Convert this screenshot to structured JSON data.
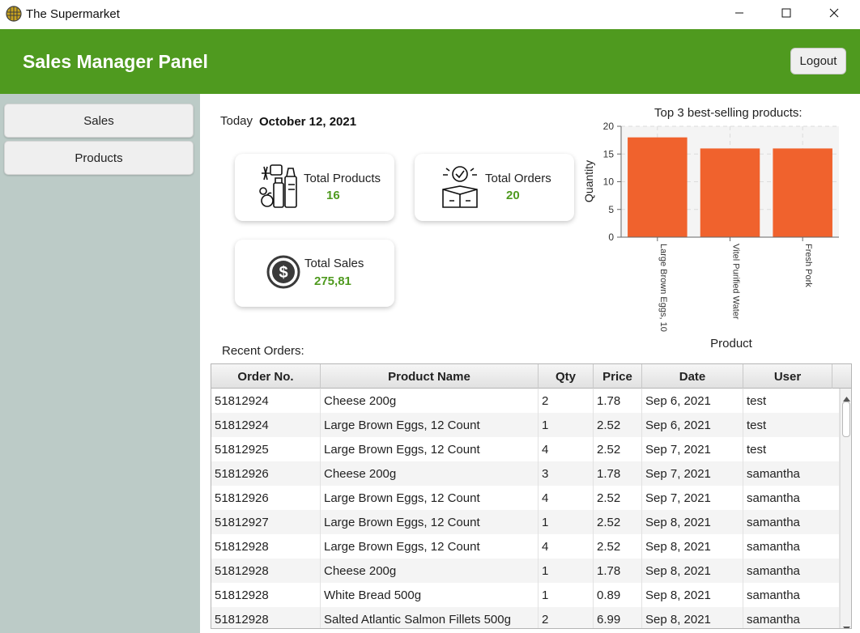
{
  "window": {
    "title": "The Supermarket",
    "app_icon": "basket-globe-icon",
    "controls": [
      "minimize-icon",
      "maximize-icon",
      "close-icon"
    ]
  },
  "header": {
    "title": "Sales Manager Panel",
    "logout_label": "Logout",
    "background": "#4f9a1f"
  },
  "sidebar": {
    "background": "#bccbc7",
    "items": [
      {
        "label": "Sales"
      },
      {
        "label": "Products"
      }
    ]
  },
  "today": {
    "label": "Today",
    "date": "October 12, 2021"
  },
  "cards": {
    "products": {
      "label": "Total Products",
      "value": "16",
      "icon": "groceries-icon"
    },
    "orders": {
      "label": "Total Orders",
      "value": "20",
      "icon": "delivery-box-icon"
    },
    "sales": {
      "label": "Total Sales",
      "value": "275,81",
      "icon": "dollar-coin-icon"
    }
  },
  "chart_data": {
    "type": "bar",
    "title": "Top 3 best-selling products:",
    "xlabel": "Product",
    "ylabel": "Quantity",
    "categories": [
      "Large Brown Eggs, 10",
      "Vitel Purified Water",
      "Fresh Pork"
    ],
    "values": [
      18,
      16,
      16
    ],
    "ylim": [
      0,
      20
    ],
    "yticks": [
      "0",
      "5",
      "10",
      "15",
      "20"
    ],
    "grid": true,
    "bar_color": "#f0622d"
  },
  "orders": {
    "label": "Recent Orders:",
    "columns": [
      "Order No.",
      "Product Name",
      "Qty",
      "Price",
      "Date",
      "User"
    ],
    "rows": [
      [
        "51812924",
        "Cheese 200g",
        "2",
        "1.78",
        "Sep 6, 2021",
        "test"
      ],
      [
        "51812924",
        "Large Brown Eggs, 12 Count",
        "1",
        "2.52",
        "Sep 6, 2021",
        "test"
      ],
      [
        "51812925",
        "Large Brown Eggs, 12 Count",
        "4",
        "2.52",
        "Sep 7, 2021",
        "test"
      ],
      [
        "51812926",
        "Cheese 200g",
        "3",
        "1.78",
        "Sep 7, 2021",
        "samantha"
      ],
      [
        "51812926",
        "Large Brown Eggs, 12 Count",
        "4",
        "2.52",
        "Sep 7, 2021",
        "samantha"
      ],
      [
        "51812927",
        "Large Brown Eggs, 12 Count",
        "1",
        "2.52",
        "Sep 8, 2021",
        "samantha"
      ],
      [
        "51812928",
        "Large Brown Eggs, 12 Count",
        "4",
        "2.52",
        "Sep 8, 2021",
        "samantha"
      ],
      [
        "51812928",
        "Cheese 200g",
        "1",
        "1.78",
        "Sep 8, 2021",
        "samantha"
      ],
      [
        "51812928",
        "White Bread 500g",
        "1",
        "0.89",
        "Sep 8, 2021",
        "samantha"
      ],
      [
        "51812928",
        "Salted Atlantic Salmon Fillets 500g",
        "2",
        "6.99",
        "Sep 8, 2021",
        "samantha"
      ]
    ]
  }
}
